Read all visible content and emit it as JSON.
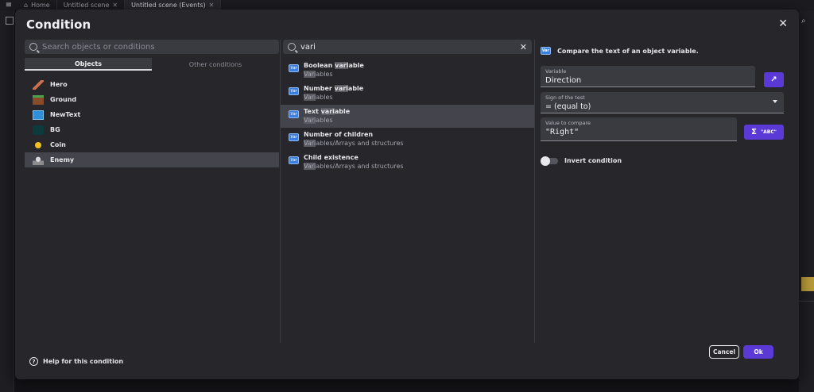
{
  "appbar": {
    "tabs": [
      {
        "label": "Home"
      },
      {
        "label": "Untitled scene"
      },
      {
        "label": "Untitled scene (Events)"
      }
    ]
  },
  "dialog": {
    "title": "Condition",
    "left": {
      "search_placeholder": "Search objects or conditions",
      "tabs": [
        {
          "label": "Objects",
          "active": true
        },
        {
          "label": "Other conditions",
          "active": false
        }
      ],
      "objects": [
        {
          "name": "Hero",
          "icon": "hero-sprite-icon"
        },
        {
          "name": "Ground",
          "icon": "ground-tile-icon"
        },
        {
          "name": "NewText",
          "icon": "text-object-icon"
        },
        {
          "name": "BG",
          "icon": "background-icon"
        },
        {
          "name": "Coin",
          "icon": "coin-icon"
        },
        {
          "name": "Enemy",
          "icon": "enemy-sprite-icon",
          "selected": true
        }
      ]
    },
    "middle": {
      "search_value": "vari",
      "conditions": [
        {
          "name_pre": "Boolean ",
          "name_hl": "vari",
          "name_post": "able",
          "sub_hl": "Vari",
          "sub_post": "ables"
        },
        {
          "name_pre": "Number ",
          "name_hl": "vari",
          "name_post": "able",
          "sub_hl": "Vari",
          "sub_post": "ables"
        },
        {
          "name_pre": "Text ",
          "name_hl": "vari",
          "name_post": "able",
          "sub_hl": "Vari",
          "sub_post": "ables",
          "selected": true
        },
        {
          "name_pre": "Number of children",
          "name_hl": "",
          "name_post": "",
          "sub_hl": "Vari",
          "sub_post": "ables/Arrays and structures"
        },
        {
          "name_pre": "Child existence",
          "name_hl": "",
          "name_post": "",
          "sub_hl": "Vari",
          "sub_post": "ables/Arrays and structures"
        }
      ],
      "icon_text": "Var"
    },
    "right": {
      "description": "Compare the text of an object variable.",
      "variable": {
        "label": "Variable",
        "value": "Direction"
      },
      "sign": {
        "label": "Sign of the test",
        "value": "= (equal to)"
      },
      "compare": {
        "label": "Value to compare",
        "value": "\"Right\""
      },
      "expression_button": "\"ABC\"",
      "invert_label": "Invert condition"
    },
    "footer": {
      "help": "Help for this condition",
      "cancel": "Cancel",
      "ok": "Ok"
    }
  }
}
